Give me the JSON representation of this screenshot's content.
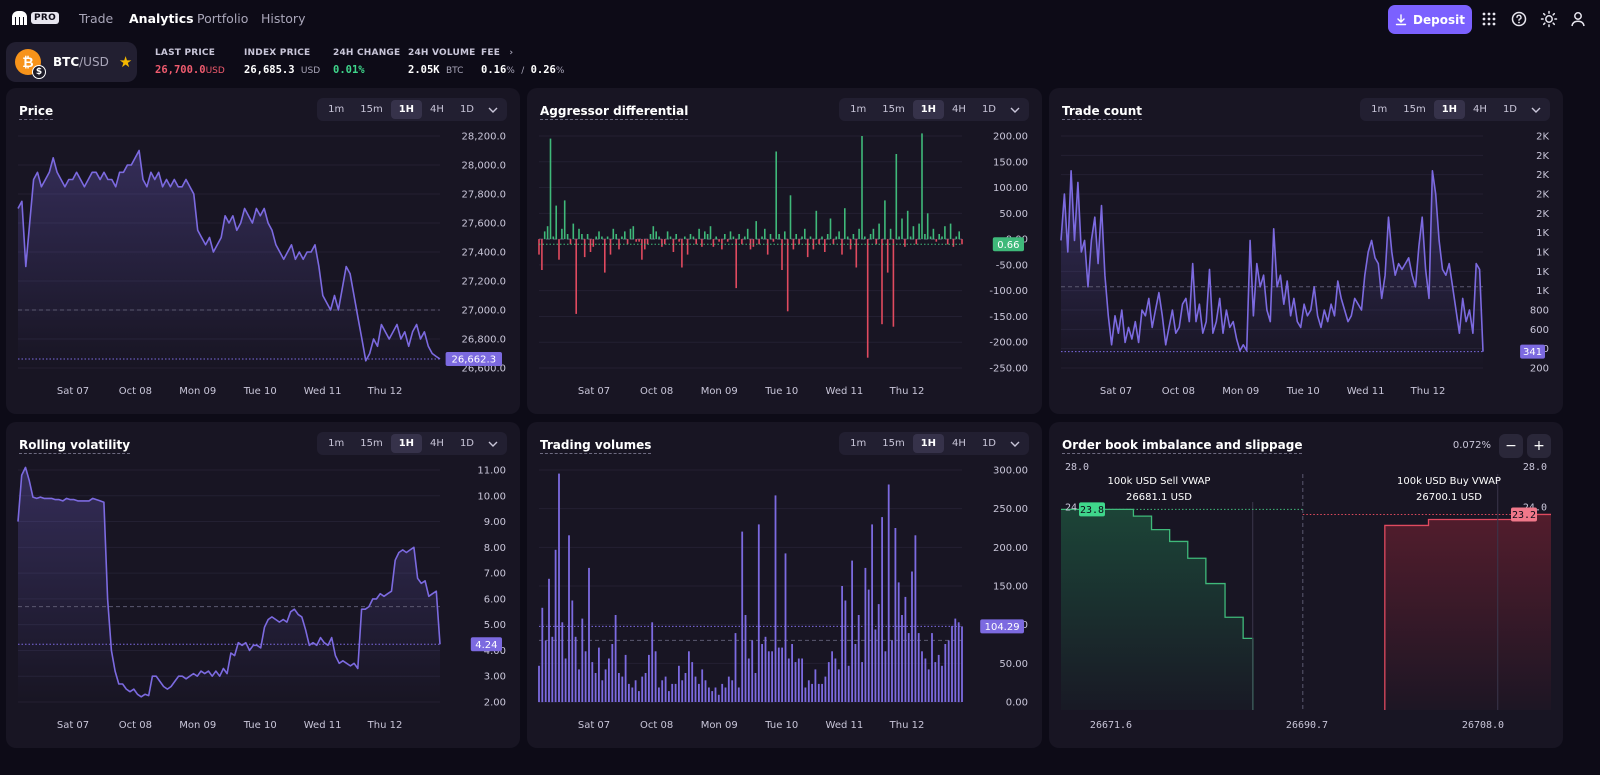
{
  "nav": {
    "logo_badge": "PRO",
    "links": [
      "Trade",
      "Analytics",
      "Portfolio",
      "History"
    ],
    "active": "Analytics",
    "deposit_label": "Deposit",
    "accent": "#7b61ff"
  },
  "ticker": {
    "pair_base": "BTC",
    "pair_quote": "/USD",
    "coin_icon": "bitcoin-icon",
    "favorite": true,
    "last_price_label": "LAST PRICE",
    "last_price": "26,700.0",
    "last_price_unit": "USD",
    "index_price_label": "INDEX PRICE",
    "index_price": "26,685.3",
    "index_price_unit": "USD",
    "change_label": "24H CHANGE",
    "change": "0.01%",
    "volume_label": "24H VOLUME",
    "volume": "2.05K",
    "volume_unit": "BTC",
    "fee_label": "FEE",
    "fee_maker": "0.16",
    "fee_taker": "0.26",
    "fee_pct": "%",
    "fee_sep": "/"
  },
  "colors": {
    "line": "#7c6ae0",
    "up": "#3fb97a",
    "down": "#e04a5f",
    "bg": "#0d0b17",
    "panel": "#181523"
  },
  "timeframes": [
    "1m",
    "15m",
    "1H",
    "4H",
    "1D"
  ],
  "active_timeframe": "1H",
  "panels": {
    "price": "Price",
    "aggressor": "Aggressor differential",
    "trades": "Trade count",
    "volatility": "Rolling volatility",
    "volumes": "Trading volumes",
    "orderbook": "Order book imbalance and slippage"
  },
  "orderbook": {
    "pct": "0.072%",
    "sell_label": "100k USD Sell VWAP",
    "sell_value": "26681.1",
    "buy_label": "100k USD Buy VWAP",
    "buy_value": "26700.1",
    "unit": "USD",
    "bid_badge": "23.8",
    "ask_badge": "23.2",
    "bid_left_tick": "24.",
    "ask_right_tick": "24.0",
    "y_top": "28.0",
    "x_ticks": [
      "26671.6",
      "26690.7",
      "26708.0"
    ],
    "bid_steps": [
      [
        26671.6,
        23.8
      ],
      [
        26674.8,
        23.0
      ],
      [
        26676.5,
        21.4
      ],
      [
        26678.2,
        20.0
      ],
      [
        26679.9,
        18.0
      ],
      [
        26681.6,
        15.0
      ],
      [
        26683.4,
        11.0
      ],
      [
        26685.1,
        8.5
      ],
      [
        26686.0,
        0
      ]
    ],
    "ask_steps": [
      [
        26698.4,
        21.9
      ],
      [
        26702.5,
        22.6
      ],
      [
        26712.0,
        23.2
      ]
    ]
  },
  "chart_data": [
    {
      "type": "line",
      "title": "Price",
      "x_ticks": [
        "Sat 07",
        "Oct 08",
        "Mon 09",
        "Tue 10",
        "Wed 11",
        "Thu 12"
      ],
      "y_ticks": [
        "28,200.0",
        "28,000.0",
        "27,800.0",
        "27,600.0",
        "27,400.0",
        "27,200.0",
        "27,000.0",
        "26,800.0",
        "26,600.0"
      ],
      "ylim": [
        26600,
        28200
      ],
      "current_label": "26,662.3",
      "reference_level": 27000,
      "values": [
        27700,
        27750,
        27300,
        27600,
        27900,
        27950,
        27850,
        27900,
        27950,
        28050,
        27950,
        27900,
        27850,
        27900,
        27900,
        27950,
        27900,
        27850,
        27900,
        27950,
        27950,
        27900,
        27950,
        27900,
        27900,
        27850,
        27950,
        27950,
        28000,
        28000,
        28050,
        28100,
        27900,
        27850,
        27950,
        27900,
        27950,
        27850,
        27900,
        27850,
        27900,
        27850,
        27850,
        27900,
        27850,
        27800,
        27550,
        27500,
        27450,
        27500,
        27400,
        27450,
        27500,
        27650,
        27600,
        27650,
        27550,
        27600,
        27700,
        27650,
        27600,
        27700,
        27650,
        27700,
        27600,
        27550,
        27450,
        27400,
        27350,
        27400,
        27450,
        27350,
        27400,
        27350,
        27400,
        27400,
        27450,
        27300,
        27100,
        27050,
        27000,
        27100,
        27000,
        27150,
        27300,
        27250,
        27100,
        26950,
        26800,
        26650,
        26700,
        26800,
        26750,
        26900,
        26850,
        26800,
        26850,
        26900,
        26800,
        26850,
        26750,
        26850,
        26900,
        26800,
        26850,
        26750,
        26700,
        26680,
        26662.3
      ]
    },
    {
      "type": "bar",
      "title": "Aggressor differential",
      "x_ticks": [
        "Sat 07",
        "Oct 08",
        "Mon 09",
        "Tue 10",
        "Wed 11",
        "Thu 12"
      ],
      "y_ticks": [
        "200.00",
        "150.00",
        "100.00",
        "50.00",
        "0.00",
        "-50.00",
        "-100.00",
        "-150.00",
        "-200.00",
        "-250.00"
      ],
      "ylim": [
        -250,
        200
      ],
      "current_label": "0.66",
      "values": [
        -30,
        -60,
        15,
        25,
        195,
        5,
        65,
        -40,
        20,
        75,
        10,
        -10,
        30,
        -145,
        20,
        10,
        -35,
        10,
        -25,
        -15,
        5,
        15,
        5,
        -65,
        5,
        -30,
        20,
        10,
        -20,
        5,
        15,
        -10,
        20,
        25,
        -5,
        -5,
        -40,
        -20,
        -10,
        10,
        25,
        15,
        5,
        -15,
        -10,
        15,
        5,
        -25,
        10,
        -5,
        -55,
        5,
        -30,
        10,
        5,
        -10,
        20,
        -15,
        15,
        10,
        25,
        -15,
        5,
        -5,
        -20,
        10,
        -5,
        15,
        5,
        -95,
        10,
        -10,
        5,
        20,
        -20,
        -15,
        35,
        -10,
        5,
        20,
        -30,
        10,
        -5,
        170,
        10,
        -60,
        15,
        -140,
        85,
        -20,
        10,
        -10,
        5,
        20,
        -35,
        5,
        -20,
        55,
        -10,
        5,
        -25,
        10,
        40,
        -10,
        5,
        15,
        -30,
        60,
        5,
        -20,
        10,
        -55,
        20,
        200,
        5,
        -230,
        10,
        20,
        -10,
        30,
        -165,
        75,
        -65,
        20,
        -170,
        165,
        5,
        40,
        -15,
        55,
        5,
        25,
        -10,
        30,
        205,
        10,
        50,
        5,
        20,
        -5,
        10,
        5,
        25,
        -10,
        30,
        -15,
        5,
        15,
        -10
      ]
    },
    {
      "type": "line",
      "title": "Trade count",
      "x_ticks": [
        "Sat 07",
        "Oct 08",
        "Mon 09",
        "Tue 10",
        "Wed 11",
        "Thu 12"
      ],
      "y_ticks": [
        "2K",
        "2K",
        "2K",
        "2K",
        "2K",
        "1K",
        "1K",
        "1K",
        "1K",
        "800",
        "600",
        "400",
        "200"
      ],
      "ylim": [
        200,
        2200
      ],
      "current_label": "341",
      "reference_level": 900,
      "values": [
        1300,
        1700,
        1200,
        1900,
        1300,
        1800,
        1200,
        1300,
        900,
        1300,
        1500,
        1100,
        1600,
        1000,
        650,
        400,
        650,
        500,
        700,
        420,
        550,
        450,
        600,
        420,
        700,
        650,
        800,
        550,
        700,
        850,
        650,
        400,
        550,
        700,
        500,
        550,
        750,
        800,
        600,
        1100,
        600,
        750,
        500,
        600,
        1050,
        500,
        600,
        800,
        500,
        700,
        550,
        600,
        450,
        350,
        400,
        350,
        1300,
        650,
        1100,
        900,
        1000,
        700,
        600,
        1400,
        900,
        1000,
        750,
        950,
        650,
        800,
        600,
        550,
        750,
        650,
        700,
        900,
        650,
        550,
        700,
        600,
        750,
        650,
        950,
        800,
        700,
        600,
        650,
        800,
        750,
        700,
        1000,
        1200,
        1300,
        1150,
        1100,
        800,
        1000,
        1500,
        1200,
        1000,
        1100,
        1050,
        1100,
        1150,
        1000,
        900,
        1250,
        1500,
        1050,
        800,
        1900,
        1700,
        1300,
        1050,
        1000,
        1100,
        900,
        700,
        500,
        800,
        600,
        700,
        500,
        1100,
        1050,
        341
      ]
    },
    {
      "type": "line",
      "title": "Rolling volatility",
      "x_ticks": [
        "Sat 07",
        "Oct 08",
        "Mon 09",
        "Tue 10",
        "Wed 11",
        "Thu 12"
      ],
      "y_ticks": [
        "11.00",
        "10.00",
        "9.00",
        "8.00",
        "7.00",
        "6.00",
        "5.00",
        "4.00",
        "3.00",
        "2.00"
      ],
      "ylim": [
        2,
        11
      ],
      "current_label": "4.24",
      "reference_level": 5.7,
      "values": [
        9.0,
        10.8,
        11.1,
        10.6,
        9.95,
        9.9,
        9.95,
        9.9,
        9.9,
        9.9,
        9.85,
        9.85,
        9.8,
        9.9,
        9.85,
        9.85,
        9.8,
        9.8,
        9.8,
        9.8,
        9.9,
        9.85,
        9.8,
        9.75,
        6.0,
        4.0,
        3.2,
        2.7,
        2.7,
        2.5,
        2.4,
        2.5,
        2.3,
        2.2,
        2.3,
        2.25,
        3.0,
        3.0,
        2.8,
        2.6,
        2.5,
        2.6,
        2.8,
        3.0,
        3.0,
        2.9,
        3.0,
        3.1,
        3.0,
        3.2,
        3.1,
        3.2,
        3.0,
        3.2,
        3.0,
        3.3,
        3.1,
        3.9,
        3.8,
        4.3,
        4.2,
        4.3,
        4.0,
        4.2,
        4.2,
        4.1,
        4.9,
        5.2,
        5.3,
        5.2,
        5.1,
        5.2,
        5.1,
        5.5,
        5.6,
        5.4,
        5.3,
        4.8,
        4.2,
        4.3,
        4.2,
        4.5,
        4.3,
        4.2,
        4.5,
        3.8,
        3.5,
        3.6,
        3.5,
        3.4,
        3.5,
        3.3,
        5.6,
        5.6,
        5.7,
        6.0,
        6.0,
        6.2,
        6.1,
        6.2,
        6.3,
        7.5,
        7.8,
        7.9,
        7.8,
        7.9,
        8.0,
        6.8,
        6.6,
        6.7,
        6.1,
        6.2,
        6.3,
        4.24
      ]
    },
    {
      "type": "bar",
      "title": "Trading volumes",
      "x_ticks": [
        "Sat 07",
        "Oct 08",
        "Mon 09",
        "Tue 10",
        "Wed 11",
        "Thu 12"
      ],
      "y_ticks": [
        "300.00",
        "250.00",
        "200.00",
        "150.00",
        "100.00",
        "50.00",
        "0.00"
      ],
      "ylim": [
        0,
        320
      ],
      "current_label": "104.29",
      "reference_level": 85,
      "values": [
        50,
        130,
        85,
        170,
        90,
        210,
        315,
        110,
        60,
        230,
        140,
        90,
        45,
        115,
        70,
        185,
        55,
        40,
        75,
        30,
        45,
        60,
        80,
        120,
        40,
        35,
        65,
        25,
        20,
        30,
        15,
        35,
        40,
        65,
        110,
        70,
        20,
        30,
        35,
        15,
        25,
        25,
        50,
        30,
        40,
        70,
        55,
        35,
        25,
        45,
        30,
        20,
        15,
        20,
        10,
        25,
        20,
        35,
        30,
        95,
        20,
        235,
        120,
        60,
        85,
        40,
        245,
        80,
        90,
        70,
        70,
        285,
        75,
        75,
        205,
        60,
        80,
        55,
        60,
        60,
        20,
        30,
        25,
        45,
        25,
        25,
        35,
        55,
        70,
        60,
        45,
        160,
        140,
        50,
        195,
        80,
        120,
        55,
        185,
        155,
        245,
        100,
        135,
        255,
        70,
        300,
        85,
        240,
        165,
        120,
        145,
        95,
        180,
        230,
        95,
        70,
        60,
        45,
        95,
        55,
        65,
        50,
        80,
        85,
        105,
        115,
        110,
        104.29
      ]
    }
  ]
}
